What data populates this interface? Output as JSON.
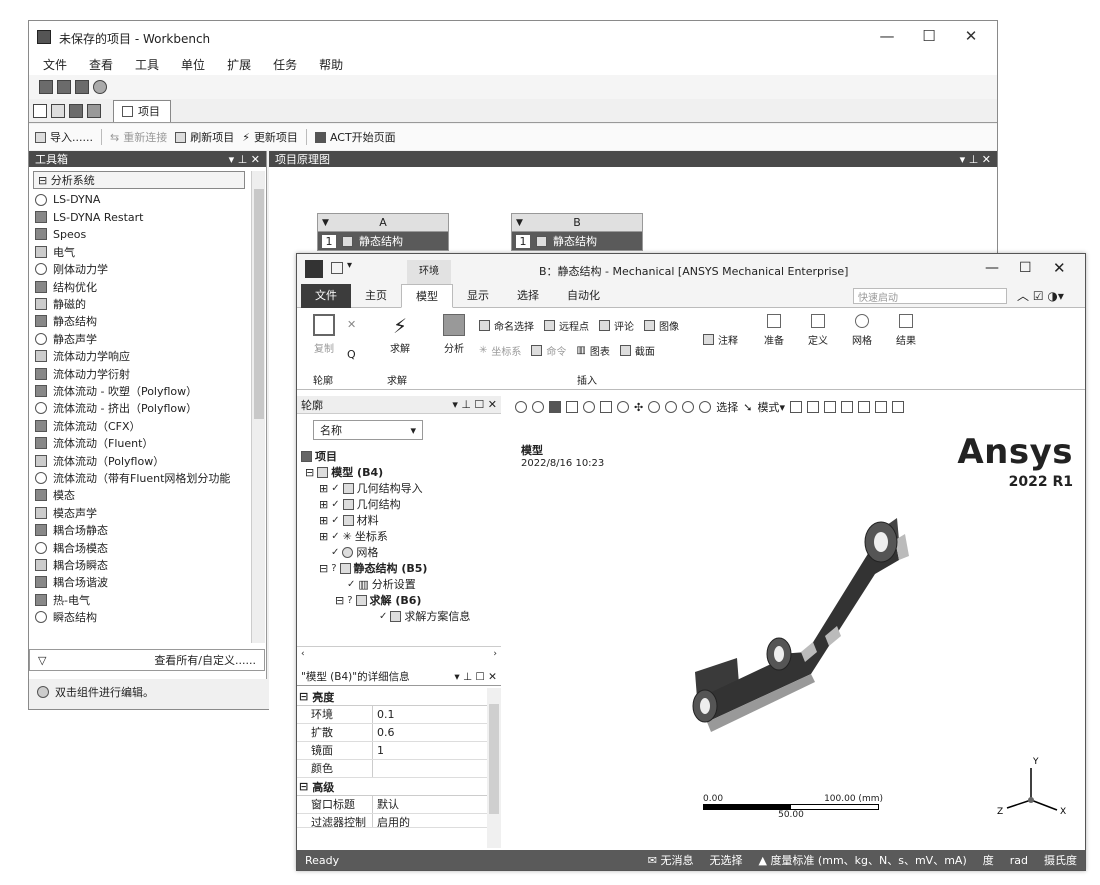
{
  "workbench": {
    "title": "未保存的项目 - Workbench",
    "menu": [
      "文件",
      "查看",
      "工具",
      "单位",
      "扩展",
      "任务",
      "帮助"
    ],
    "tab_label": "项目",
    "toolbar": {
      "import": "导入......",
      "reconnect": "重新连接",
      "refresh": "刷新项目",
      "update": "更新项目",
      "act": "ACT开始页面"
    },
    "toolbox": {
      "title": "工具箱",
      "group": "分析系统",
      "items": [
        "LS-DYNA",
        "LS-DYNA Restart",
        "Speos",
        "电气",
        "刚体动力学",
        "结构优化",
        "静磁的",
        "静态结构",
        "静态声学",
        "流体动力学响应",
        "流体动力学衍射",
        "流体流动 - 吹塑（Polyflow）",
        "流体流动 - 挤出（Polyflow）",
        "流体流动（CFX）",
        "流体流动（Fluent）",
        "流体流动（Polyflow）",
        "流体流动（带有Fluent网格划分功能",
        "模态",
        "模态声学",
        "耦合场静态",
        "耦合场模态",
        "耦合场瞬态",
        "耦合场谐波",
        "热-电气",
        "瞬态结构"
      ],
      "footer": "查看所有/自定义......"
    },
    "status": "双击组件进行编辑。",
    "schematic": {
      "title": "项目原理图",
      "systems": [
        {
          "letter": "A",
          "row_num": "1",
          "row_label": "静态结构"
        },
        {
          "letter": "B",
          "row_num": "1",
          "row_label": "静态结构"
        }
      ]
    }
  },
  "mechanical": {
    "context_tab": "环境",
    "title": "B：静态结构 - Mechanical [ANSYS Mechanical Enterprise]",
    "tabs": [
      "文件",
      "主页",
      "模型",
      "显示",
      "选择",
      "自动化"
    ],
    "active_tab": "模型",
    "quick_launch": "快速启动",
    "ribbon": {
      "copy": "复制",
      "solve": "求解",
      "analysis": "分析",
      "named_sel": "命名选择",
      "remote_pt": "远程点",
      "comment": "评论",
      "image": "图像",
      "annotation": "注释",
      "coord": "坐标系",
      "command": "命令",
      "chart": "图表",
      "section": "截面",
      "prepare": "准备",
      "define": "定义",
      "mesh": "网格",
      "results": "结果",
      "group_outline": "轮廓",
      "group_solve": "求解",
      "group_insert": "插入"
    },
    "outline": {
      "title": "轮廓",
      "name_filter": "名称",
      "tree": [
        {
          "label": "项目",
          "bold": true
        },
        {
          "label": "模型 (B4)",
          "bold": true
        },
        {
          "label": "几何结构导入",
          "bold": false
        },
        {
          "label": "几何结构",
          "bold": false
        },
        {
          "label": "材料",
          "bold": false
        },
        {
          "label": "坐标系",
          "bold": false
        },
        {
          "label": "网格",
          "bold": false
        },
        {
          "label": "静态结构 (B5)",
          "bold": true
        },
        {
          "label": "分析设置",
          "bold": false
        },
        {
          "label": "求解 (B6)",
          "bold": true
        },
        {
          "label": "求解方案信息",
          "bold": false
        }
      ]
    },
    "details": {
      "title": "\"模型 (B4)\"的详细信息",
      "group_brightness": "亮度",
      "rows": [
        {
          "k": "环境",
          "v": "0.1"
        },
        {
          "k": "扩散",
          "v": "0.6"
        },
        {
          "k": "镜面",
          "v": "1"
        },
        {
          "k": "颜色",
          "v": ""
        }
      ],
      "group_advanced": "高级",
      "rows2": [
        {
          "k": "窗口标题",
          "v": "默认"
        },
        {
          "k": "过滤器控制",
          "v": "启用的"
        }
      ]
    },
    "graphics": {
      "select_label": "选择",
      "mode_label": "模式",
      "model_title": "模型",
      "date": "2022/8/16 10:23",
      "brand": "Ansys",
      "version": "2022 R1",
      "scale_left": "0.00",
      "scale_right": "100.00 (mm)",
      "scale_mid": "50.00",
      "axis_x": "X",
      "axis_y": "Y",
      "axis_z": "Z"
    },
    "status": {
      "ready": "Ready",
      "messages": "无消息",
      "selection": "无选择",
      "units": "度量标准 (mm、kg、N、s、mV、mA)",
      "deg": "度",
      "rad": "rad",
      "temp": "摄氏度"
    }
  }
}
